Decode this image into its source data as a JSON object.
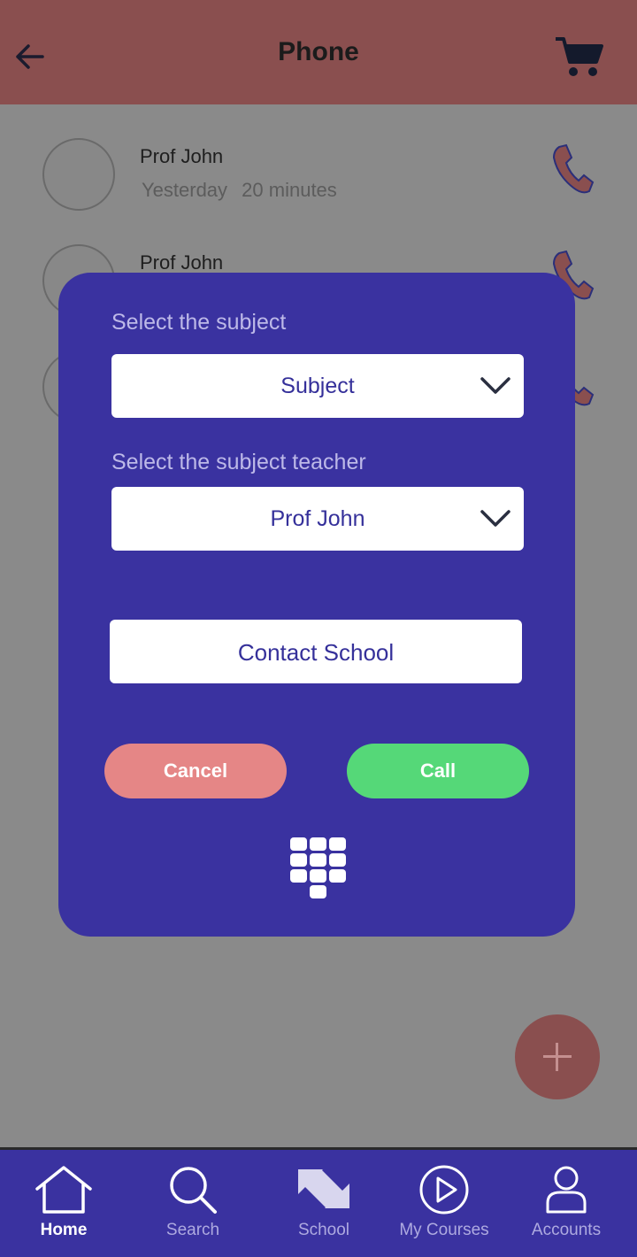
{
  "header": {
    "title": "Phone"
  },
  "calls": [
    {
      "name": "Prof John",
      "day": "Yesterday",
      "duration": "20 minutes"
    },
    {
      "name": "Prof John"
    },
    {
      "name": ""
    }
  ],
  "dialog": {
    "subject_label": "Select the subject",
    "subject_value": "Subject",
    "teacher_label": "Select the subject teacher",
    "teacher_value": "Prof John",
    "contact_label": "Contact School",
    "cancel_label": "Cancel",
    "call_label": "Call"
  },
  "tabs": [
    {
      "label": "Home",
      "icon": "home-icon",
      "active": true
    },
    {
      "label": "Search",
      "icon": "search-icon",
      "active": false
    },
    {
      "label": "School",
      "icon": "school-icon",
      "active": false
    },
    {
      "label": "My Courses",
      "icon": "play-circle-icon",
      "active": false
    },
    {
      "label": "Accounts",
      "icon": "user-icon",
      "active": false
    }
  ],
  "colors": {
    "header": "#8a4f4f",
    "dialog": "#3a32a0",
    "cancel": "#e58686",
    "call": "#55d878",
    "tabbar": "#3a32a0"
  }
}
